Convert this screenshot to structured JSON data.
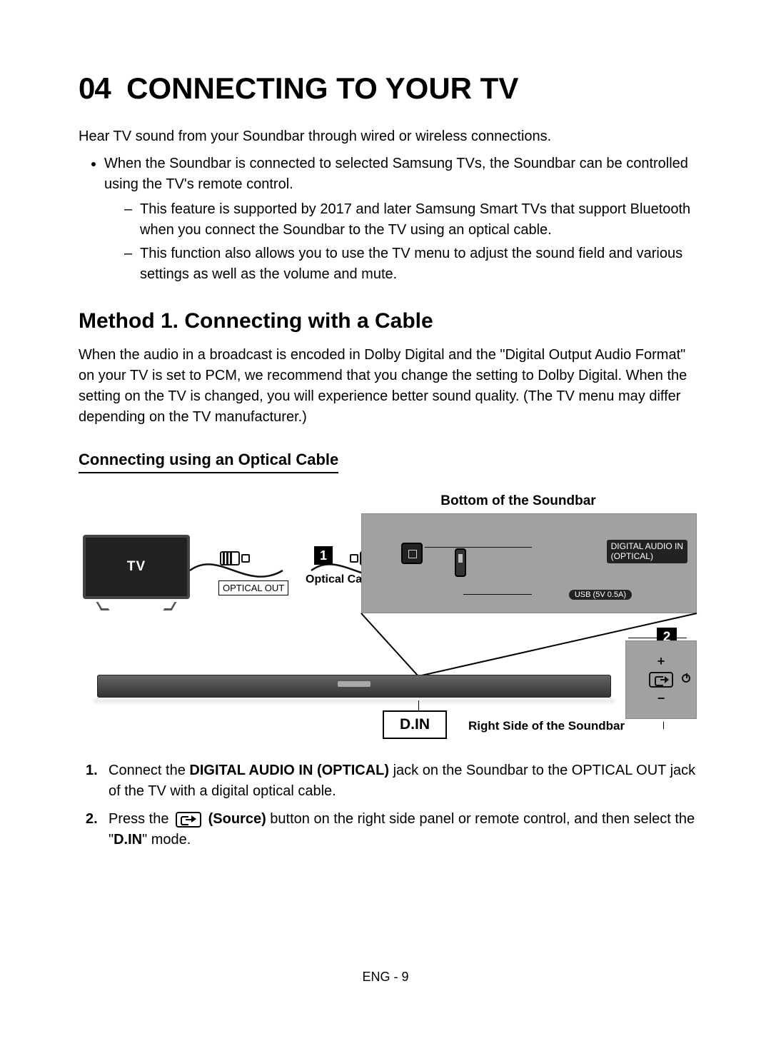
{
  "section_number": "04",
  "section_title": "CONNECTING TO YOUR TV",
  "intro": "Hear TV sound from your Soundbar through wired or wireless connections.",
  "bullet1": "When the Soundbar is connected to selected Samsung TVs, the Soundbar can be controlled using the TV's remote control.",
  "sub_a": "This feature is supported by 2017 and later Samsung Smart TVs that support Bluetooth when you connect the Soundbar to the TV using an optical cable.",
  "sub_b": "This function also allows you to use the TV menu to adjust the sound field and various settings as well as the volume and mute.",
  "method1_title": "Method 1. Connecting with a Cable",
  "method1_body": "When the audio in a broadcast is encoded in Dolby Digital and the \"Digital Output Audio Format\" on your TV is set to PCM, we recommend that you change the setting to Dolby Digital. When the setting on the TV is changed, you will experience better sound quality. (The TV menu may differ depending on the TV manufacturer.)",
  "sub_heading": "Connecting using an Optical Cable",
  "diagram": {
    "top_label": "Bottom of the Soundbar",
    "tv_label": "TV",
    "optical_out": "OPTICAL OUT",
    "optical_cable": "Optical Cable",
    "digital_audio_in": "DIGITAL AUDIO IN\n(OPTICAL)",
    "usb_label": "USB (5V 0.5A)",
    "din": "D.IN",
    "right_side": "Right Side of the Soundbar",
    "step1": "1",
    "step2": "2",
    "plus": "+",
    "minus": "−"
  },
  "step1_pre": "Connect the ",
  "step1_bold": "DIGITAL AUDIO IN (OPTICAL)",
  "step1_post": " jack on the Soundbar to the OPTICAL OUT jack of the TV with a digital optical cable.",
  "step2_pre": "Press the ",
  "step2_bold": " (Source)",
  "step2_mid": " button on the right side panel or remote control, and then select the \"",
  "step2_din": "D.IN",
  "step2_post": "\" mode.",
  "footer": "ENG - 9"
}
